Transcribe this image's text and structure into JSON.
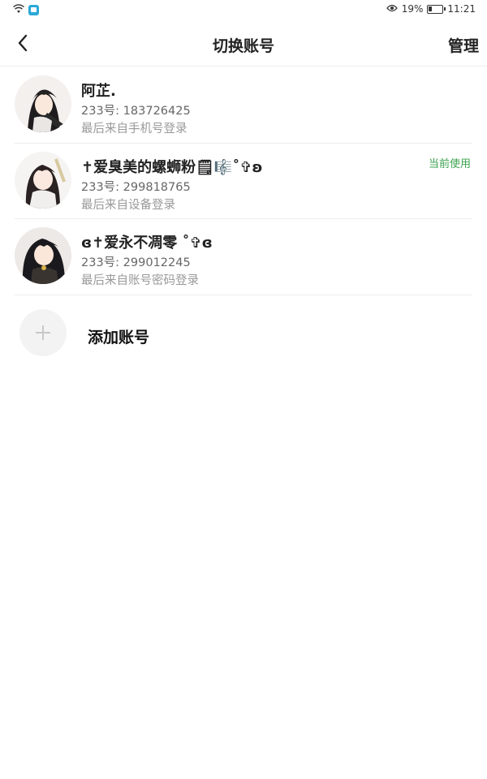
{
  "status_bar": {
    "battery_percent": "19%",
    "time": "11:21",
    "icons": [
      "wifi-icon",
      "app-notification-icon",
      "eye-icon",
      "battery-icon"
    ]
  },
  "header": {
    "title": "切换账号",
    "manage_label": "管理",
    "back_icon": "chevron-left-icon"
  },
  "accounts": [
    {
      "name": "阿芷.",
      "id_text": "233号: 183726425",
      "login_text": "最后来自手机号登录",
      "current": ""
    },
    {
      "name": "✝爱臭美的螺蛳粉🗒🎼˚✞ʚ",
      "id_text": "233号: 299818765",
      "login_text": "最后来自设备登录",
      "current": "当前使用"
    },
    {
      "name": "ɞ✝爱永不凋零 ˚✞ɞ",
      "id_text": "233号: 299012245",
      "login_text": "最后来自账号密码登录",
      "current": ""
    }
  ],
  "add_account": {
    "label": "添加账号",
    "icon": "plus-icon"
  },
  "colors": {
    "accent_green": "#3aa24e",
    "divider": "#ececec",
    "secondary_text": "#666666",
    "tertiary_text": "#999999"
  }
}
